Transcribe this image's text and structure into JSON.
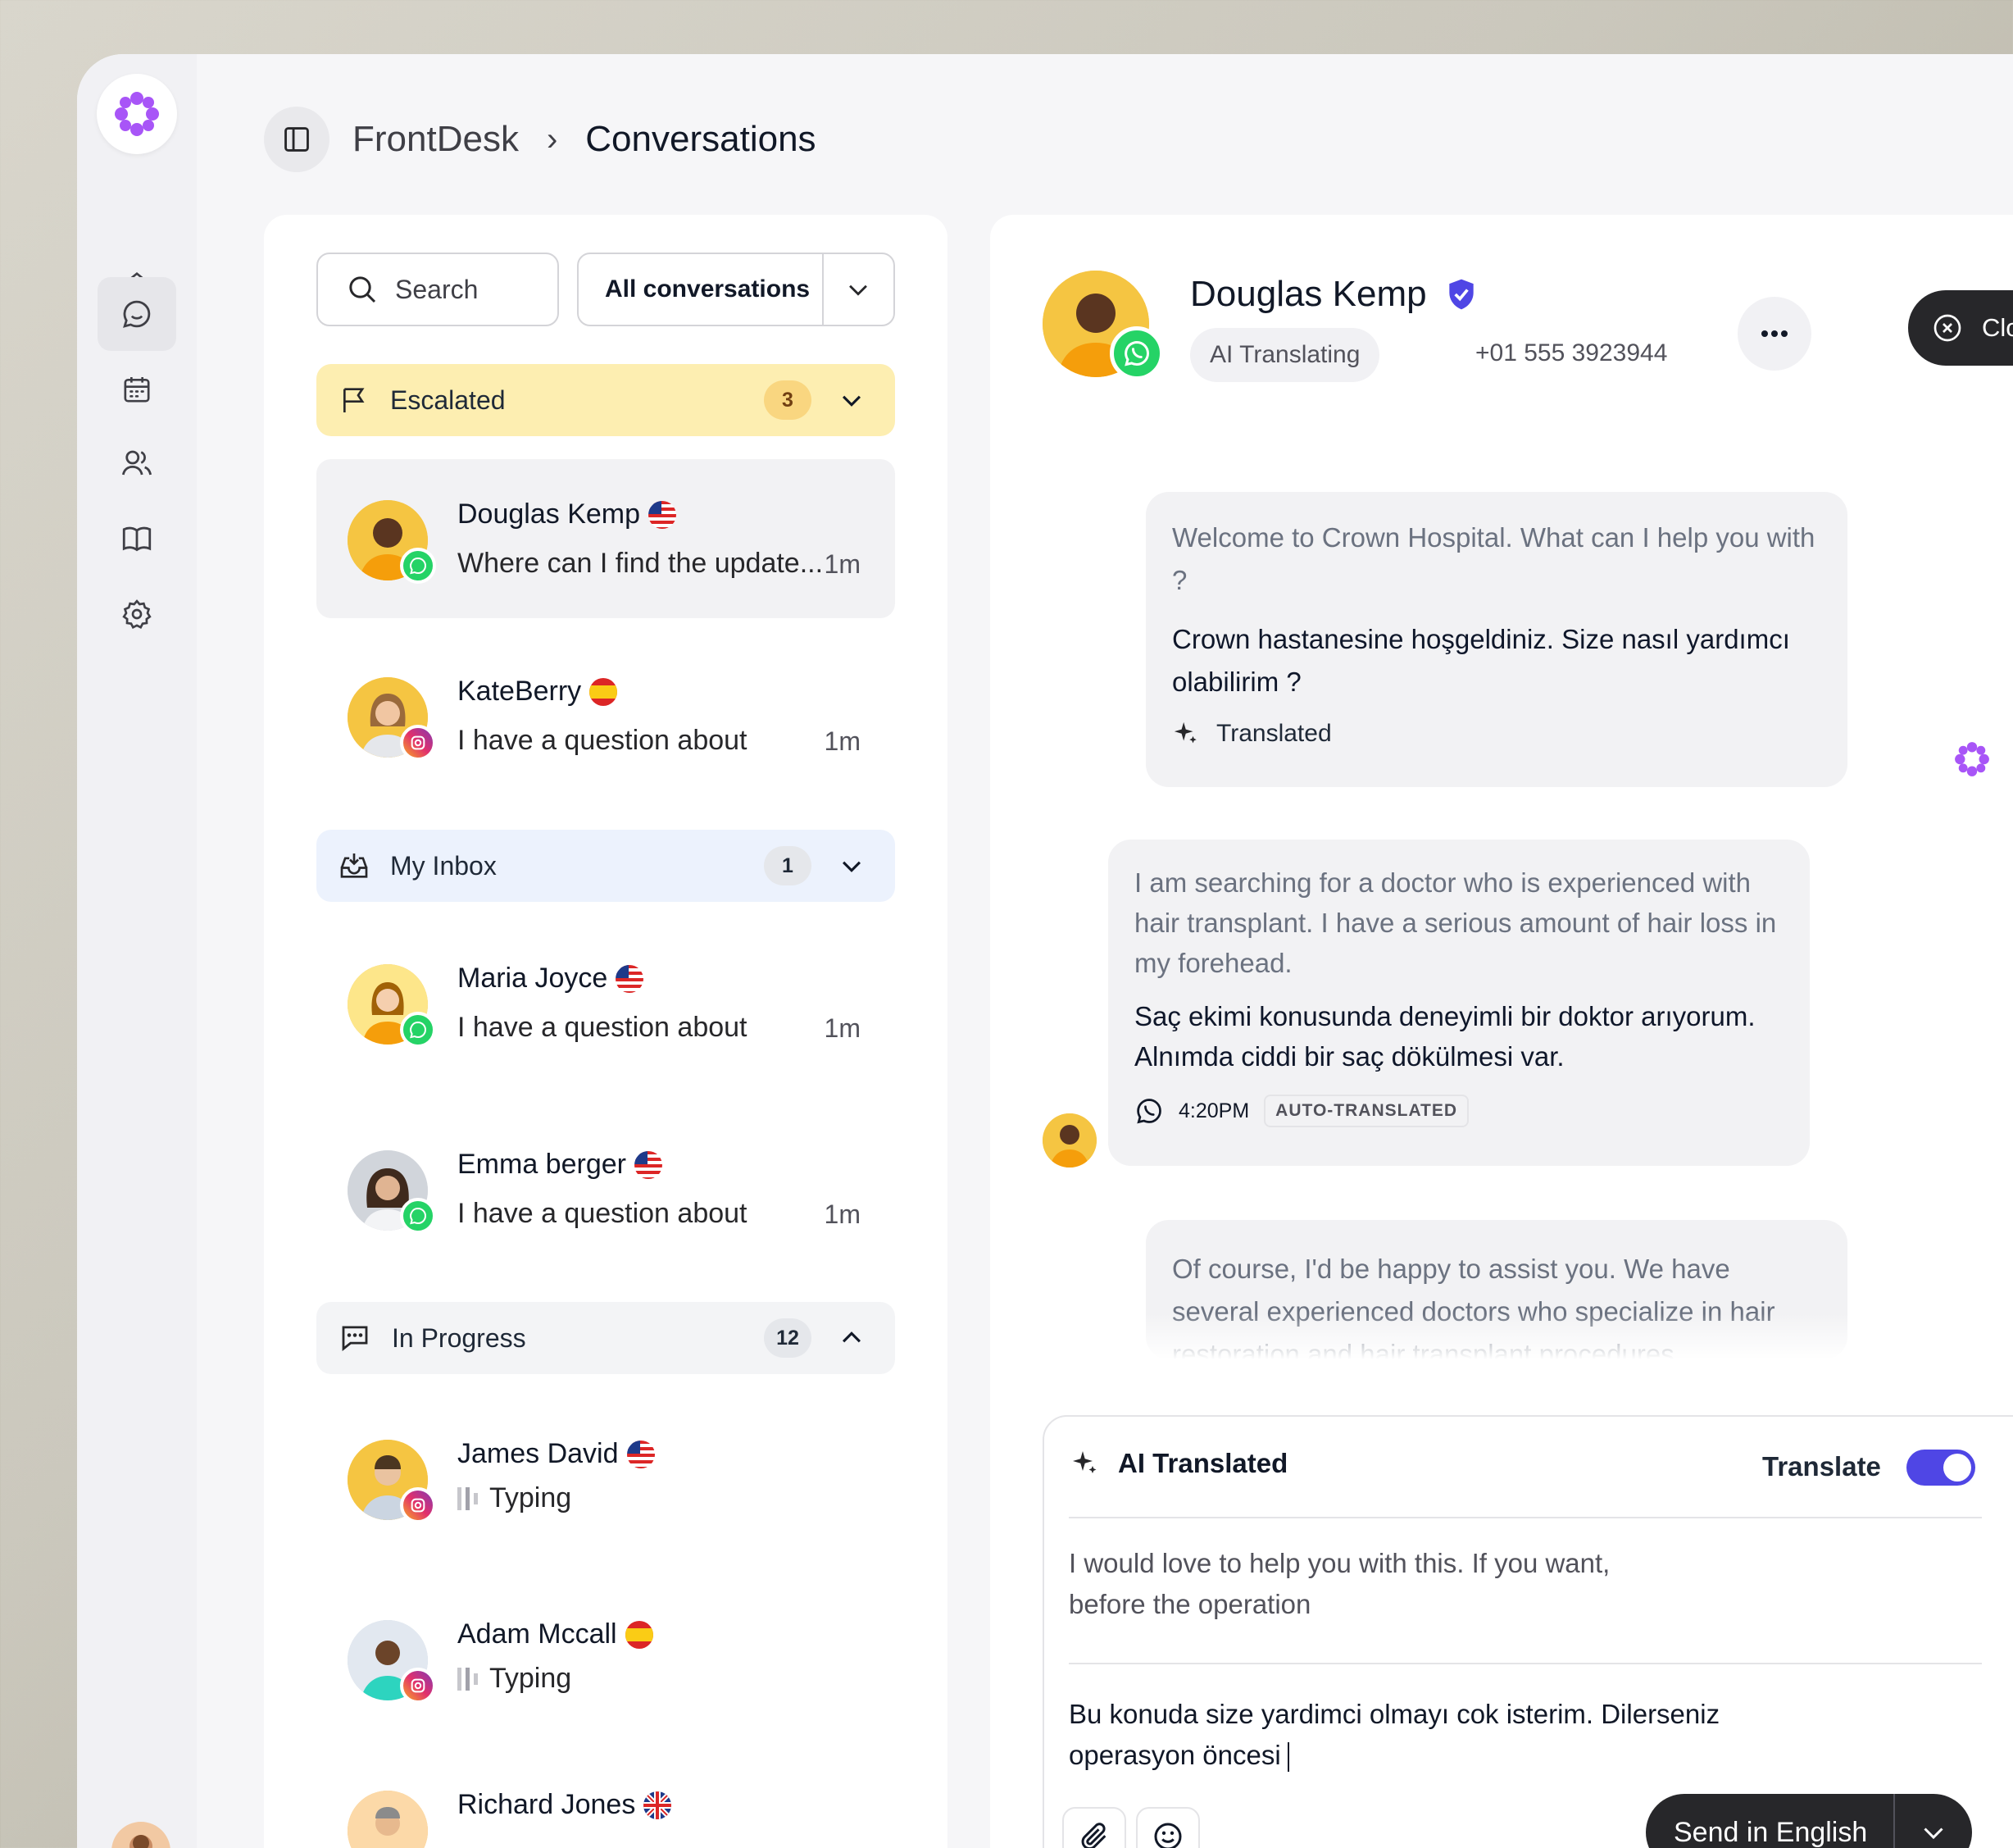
{
  "header": {
    "app": "FrontDesk",
    "separator": "›",
    "page": "Conversations"
  },
  "list": {
    "search_label": "Search",
    "filter_label": "All conversations",
    "groups": {
      "escalated": {
        "title": "Escalated",
        "count": "3"
      },
      "inbox": {
        "title": "My Inbox",
        "count": "1"
      },
      "progress": {
        "title": "In Progress",
        "count": "12"
      }
    },
    "conversations": [
      {
        "name": "Douglas Kemp",
        "message": "Where can I find the update...",
        "time": "1m",
        "channel": "whatsapp",
        "flag": "us"
      },
      {
        "name": "KateBerry",
        "message": "I have a question about",
        "time": "1m",
        "channel": "instagram",
        "flag": "es"
      },
      {
        "name": "Maria Joyce",
        "message": "I have a question about",
        "time": "1m",
        "channel": "whatsapp",
        "flag": "us"
      },
      {
        "name": "Emma berger",
        "message": "I have a question about",
        "time": "1m",
        "channel": "whatsapp",
        "flag": "us"
      },
      {
        "name": "James David",
        "message": "Typing",
        "channel": "instagram",
        "flag": "us"
      },
      {
        "name": "Adam Mccall",
        "message": "Typing",
        "channel": "instagram",
        "flag": "es"
      },
      {
        "name": "Richard Jones",
        "flag": "uk"
      }
    ]
  },
  "chat": {
    "contact_name": "Douglas Kemp",
    "pill": "AI Translating",
    "phone": "+01 555 3923944",
    "close_label": "Close",
    "messages": [
      {
        "original": "Welcome to Crown Hospital. What can I help you with ?",
        "translated": "Crown hastanesine hoşgeldiniz. Size nasıl yardımcı olabilirim ?",
        "tag": "Translated"
      },
      {
        "original": "I am searching for a doctor who is experienced with hair transplant. I have a serious amount of hair loss in my forehead.",
        "translated": "Saç ekimi konusunda deneyimli bir doktor arıyorum. Alnımda ciddi bir saç dökülmesi var.",
        "time": "4:20PM",
        "badge": "AUTO-TRANSLATED"
      },
      {
        "original": "Of course, I'd be happy to assist you. We have several experienced doctors who specialize in hair restoration and hair transplant procedures."
      }
    ],
    "composer": {
      "title": "AI Translated",
      "toggle_label": "Translate",
      "toggle_on": true,
      "source_text": "I would love to help you with this. If you want, before the operation",
      "output_text": "Bu konuda size yardimci olmayı cok isterim. Dilerseniz operasyon öncesi",
      "send_label": "Send in English"
    }
  },
  "colors": {
    "accent": "#4f46e5",
    "brand": "#a855f7",
    "escalated_bg": "#fdeeb1",
    "inbox_bg": "#ecf2fd",
    "whatsapp": "#25d366"
  },
  "icons": {
    "rail": [
      "home-icon",
      "chat-icon",
      "calendar-icon",
      "users-icon",
      "book-icon",
      "gear-icon"
    ]
  }
}
